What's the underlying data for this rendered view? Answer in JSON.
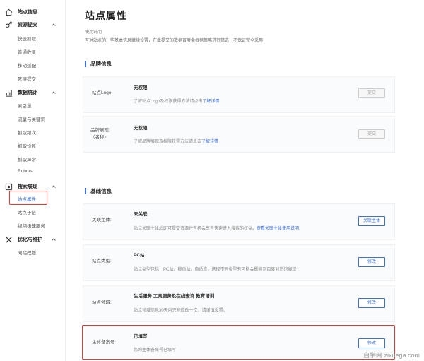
{
  "sidebar": {
    "groups": [
      {
        "label": "站点信息",
        "icon": "home-icon"
      },
      {
        "label": "资源提交",
        "icon": "link-icon"
      },
      {
        "label": "数据统计",
        "icon": "chart-icon"
      },
      {
        "label": "搜索展现",
        "icon": "search-display-icon"
      },
      {
        "label": "优化与维护",
        "icon": "tools-icon"
      }
    ],
    "submit_items": [
      "快速抓取",
      "普通收录",
      "移动适配",
      "死链提交"
    ],
    "stats_items": [
      "索引量",
      "流量与关键词",
      "抓取频次",
      "抓取诊断",
      "抓取异常",
      "Robots"
    ],
    "display_items": [
      "站点属性",
      "站点子链",
      "视频极速服务"
    ],
    "maintain_items": [
      "网站改版"
    ]
  },
  "main": {
    "title": "站点属性",
    "usage_title": "使用说明",
    "usage_text": "可对站点的一些基本信息继续设置，在此提交的数据百度会根据策略进行筛选，不保证完全采用",
    "brand": {
      "title": "品牌信息",
      "rows": [
        {
          "label": "站点Logo:",
          "value": "无权限",
          "desc": "了解站点Logo及权限获得方法请点击",
          "link": "了解详情",
          "button": "提交"
        },
        {
          "label": "品牌展现",
          "label2": "（名称）",
          "value": "无权限",
          "desc": "了解品牌展现及权限获得方法请点击",
          "link": "了解详情",
          "button": "提交"
        }
      ]
    },
    "basic": {
      "title": "基础信息",
      "rows": [
        {
          "label": "关联主体:",
          "value": "未关联",
          "desc": "站点关联主体后即可提交资源并有机会享有快速进入搜索的权益。",
          "link": "查看关联主体使用说明",
          "button": "关联主体"
        },
        {
          "label": "站点类型:",
          "value": "PC站",
          "desc": "站点类型包括：PC站、移动站、自适应，选择不同类型有可能会影响到百度对您的展现",
          "button": "修改"
        },
        {
          "label": "站点领域:",
          "value": "生活服务 工具服务及在线查询 教育培训",
          "desc": "站点领域信息30天内只能修改一次，请谨慎设置。",
          "button": "修改"
        },
        {
          "label": "主体备案号:",
          "value": "已填写",
          "desc": "您的主体备案号已填写",
          "button": "修改"
        }
      ]
    }
  },
  "watermark": "自学网 zixuega.com",
  "colors": {
    "accent": "#3a6fd8",
    "highlight": "#e53935"
  }
}
